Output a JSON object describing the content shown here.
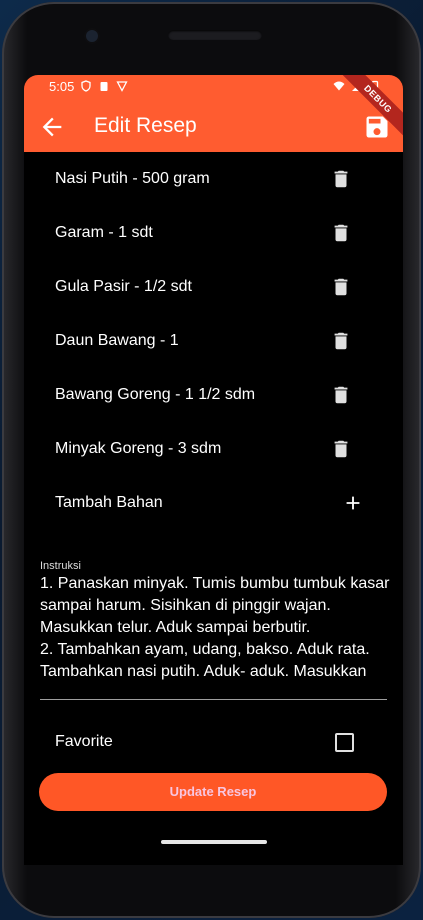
{
  "status_bar": {
    "time": "5:05"
  },
  "app_bar": {
    "title": "Edit Resep",
    "debug_banner": "DEBUG"
  },
  "ingredients": [
    {
      "label": "Nasi Putih - 500 gram"
    },
    {
      "label": "Garam - 1 sdt"
    },
    {
      "label": "Gula Pasir - 1/2 sdt"
    },
    {
      "label": "Daun Bawang - 1"
    },
    {
      "label": "Bawang Goreng - 1 1/2 sdm"
    },
    {
      "label": "Minyak Goreng - 3 sdm"
    }
  ],
  "add_ingredient": {
    "label": "Tambah Bahan"
  },
  "instructions": {
    "label": "Instruksi",
    "value": "1. Panaskan minyak. Tumis bumbu tumbuk kasar sampai harum. Sisihkan di pinggir wajan. Masukkan telur. Aduk sampai berbutir.\n2. Tambahkan ayam, udang, bakso. Aduk rata. Tambahkan nasi putih. Aduk- aduk. Masukkan"
  },
  "favorite": {
    "label": "Favorite",
    "checked": false
  },
  "update_button": {
    "label": "Update Resep"
  },
  "colors": {
    "app_bar": "#ff5c30",
    "button": "#ff5726",
    "button_text": "#f8c5e0",
    "background": "#000000"
  },
  "icons": {
    "back": "arrow-back-icon",
    "save": "save-icon",
    "delete": "trash-icon",
    "add": "plus-icon"
  }
}
